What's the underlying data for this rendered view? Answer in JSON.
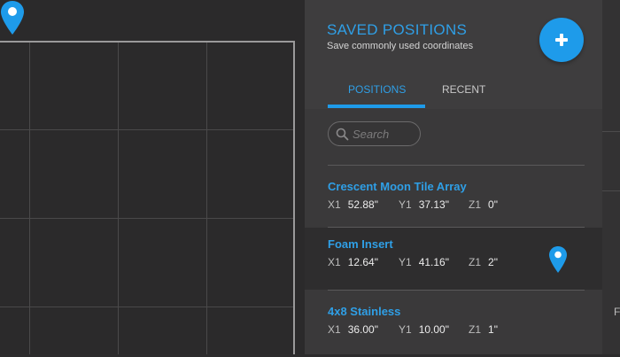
{
  "header": {
    "title": "SAVED POSITIONS",
    "subtitle": "Save commonly used coordinates",
    "add_icon": "plus-icon"
  },
  "tabs": [
    {
      "label": "POSITIONS",
      "active": true
    },
    {
      "label": "RECENT",
      "active": false
    }
  ],
  "search": {
    "placeholder": "Search",
    "value": "",
    "icon": "search-icon"
  },
  "positions": [
    {
      "name": "Crescent Moon Tile Array",
      "x_label": "X1",
      "x_value": "52.88\"",
      "y_label": "Y1",
      "y_value": "37.13\"",
      "z_label": "Z1",
      "z_value": "0\"",
      "selected": false
    },
    {
      "name": "Foam Insert",
      "x_label": "X1",
      "x_value": "12.64\"",
      "y_label": "Y1",
      "y_value": "41.16\"",
      "z_label": "Z1",
      "z_value": "2\"",
      "selected": true,
      "icon": "location-pin-icon"
    },
    {
      "name": "4x8 Stainless",
      "x_label": "X1",
      "x_value": "36.00\"",
      "y_label": "Y1",
      "y_value": "10.00\"",
      "z_label": "Z1",
      "z_value": "1\"",
      "selected": false
    }
  ],
  "edge_panel": {
    "partial_text": "F"
  },
  "colors": {
    "accent": "#1e9bea",
    "accent_text": "#2f9fe6",
    "panel_bg": "#3a393a",
    "canvas_bg": "#2b2a2b",
    "selected_row_bg": "#2e2d2e"
  }
}
